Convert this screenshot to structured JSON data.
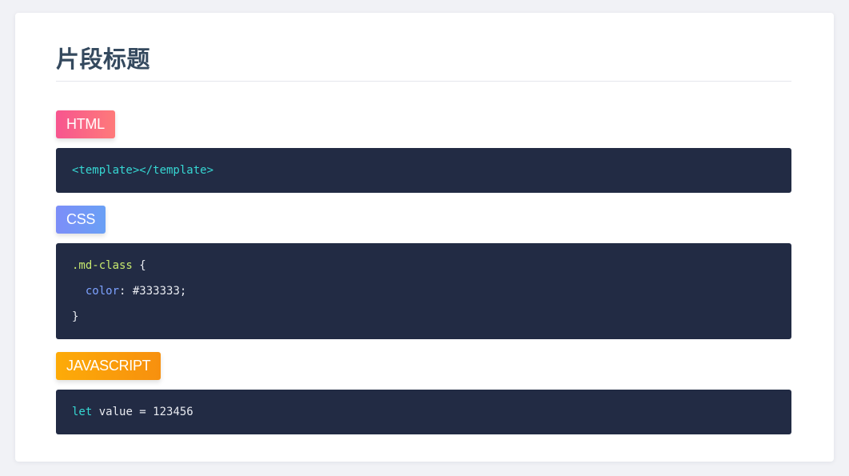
{
  "page": {
    "title": "片段标题"
  },
  "sections": [
    {
      "tag": "HTML",
      "lines": [
        [
          {
            "text": "<template></template>",
            "kind": "tag"
          }
        ]
      ]
    },
    {
      "tag": "CSS",
      "lines": [
        [
          {
            "text": ".md-class",
            "kind": "sel"
          },
          {
            "text": " {",
            "kind": "plain"
          }
        ],
        [
          {
            "text": "  color",
            "kind": "prop"
          },
          {
            "text": ": #333333;",
            "kind": "plain"
          }
        ],
        [
          {
            "text": "}",
            "kind": "plain"
          }
        ]
      ]
    },
    {
      "tag": "JAVASCRIPT",
      "lines": [
        [
          {
            "text": "let",
            "kind": "kw"
          },
          {
            "text": " value = 123456",
            "kind": "plain"
          }
        ]
      ]
    }
  ],
  "colors": {
    "html_tag_gradient": [
      "#f7558f",
      "#fe7a7a"
    ],
    "css_tag_gradient": [
      "#7c8ef8",
      "#6aa0f5"
    ],
    "js_tag_gradient": [
      "#fdab08",
      "#f7900e"
    ],
    "code_background": "#222b44",
    "title_color": "#34495e"
  }
}
